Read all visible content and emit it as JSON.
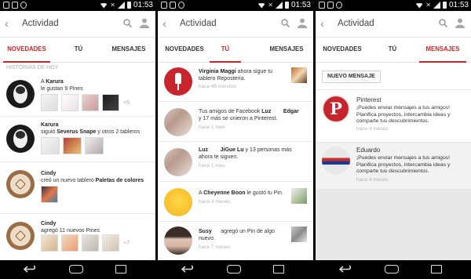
{
  "status": {
    "time": "01:53"
  },
  "app": {
    "title": "Actividad"
  },
  "tabs": [
    "NOVEDADES",
    "TÚ",
    "MENSAJES"
  ],
  "colors": {
    "accent": "#c8242b"
  },
  "feed": {
    "section_header": "HISTORIAS DE HOY",
    "items": [
      {
        "line1_pre": "A ",
        "line1_name": "Karura",
        "line2": "le gustan 9 Pines",
        "more": "+5"
      },
      {
        "line1_name": "Karura",
        "line2_pre": "siguió ",
        "line2_bold": "Severus Snape",
        "line2_post": " y otros 2 tableros"
      },
      {
        "line1_name": "Cindy",
        "line2_pre": "creó un nuevo tablero ",
        "line2_bold": "Paletas de colores"
      },
      {
        "line1_name": "Cindy",
        "line2": "agregó 11 nuevos Pines",
        "more": "+7"
      }
    ]
  },
  "you": {
    "items": [
      {
        "name": "Virginia Maggi",
        "text1": " ahora sigue tu",
        "text2": "tablero Repostería.",
        "time": "hace 45 minutos"
      },
      {
        "pre": "Tus amigos de Facebook ",
        "name": "Luz",
        "name2": "Edgar",
        "text2": "y 17 más se unieron a Pinterest.",
        "time": "hace 1 mes"
      },
      {
        "name": "Luz",
        "name2": "JiGue Lu",
        "text1": " y 13 personas más",
        "text2": "ahora te siguen.",
        "time": "hace 1 mes"
      },
      {
        "pre": "A ",
        "name": "Cheyenne Boon",
        "text1": " le gustó tu Pin.",
        "time": "hace 3 meses"
      },
      {
        "name": "Susy",
        "text1": "agregó un Pin de algo",
        "text2": "nuevo.",
        "time": "hace 7 meses"
      }
    ]
  },
  "messages": {
    "new_button": "NUEVO MENSAJE",
    "items": [
      {
        "name": "Pinterest",
        "l1": "¡Puedes enviar mensajes a tus amigos!",
        "l2": "Planifica proyectos, intercambia ideas y",
        "l3": "comparte tus descubrimientos.",
        "time": "hace 4 meses"
      },
      {
        "name": "Eduardo",
        "l1": "¡Puedes enviar mensajes a tus amigos!",
        "l2": "Planifica proyectos, intercambia ideas y",
        "l3": "comparte tus descubrimientos.",
        "time": "hace 4 meses"
      }
    ]
  }
}
